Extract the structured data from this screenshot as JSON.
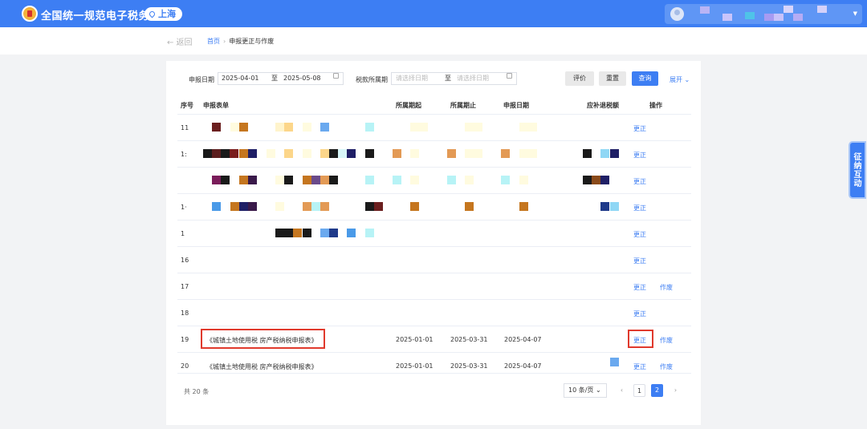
{
  "header": {
    "title": "全国统一规范电子税务局",
    "region": "上海"
  },
  "subnav": {
    "back": "← 返回",
    "breadcrumb_home": "首页",
    "breadcrumb_sep": "›",
    "breadcrumb_current": "申报更正与作废"
  },
  "filters": {
    "declare_date_label": "申报日期",
    "declare_start": "2025-04-01",
    "to_label": "至",
    "declare_end": "2025-05-08",
    "period_label": "税款所属期",
    "period_start_placeholder": "请选择日期",
    "period_end_placeholder": "请选择日期",
    "btn_evaluate": "评价",
    "btn_reset": "重置",
    "btn_query": "查询",
    "expand": "展开 ⌄"
  },
  "table": {
    "headers": [
      "序号",
      "申报表单",
      "所属期起",
      "所属期止",
      "申报日期",
      "应补退税额",
      "操作"
    ],
    "rows": [
      {
        "no": "11",
        "form": "",
        "start": "",
        "end": "",
        "date": "",
        "amount": "",
        "ops": [
          "更正"
        ]
      },
      {
        "no": "1:",
        "form": "",
        "start": "",
        "end": "",
        "date": "",
        "amount": "",
        "ops": [
          "更正"
        ]
      },
      {
        "no": "",
        "form": "",
        "start": "",
        "end": "",
        "date": "",
        "amount": "",
        "ops": [
          "更正"
        ]
      },
      {
        "no": "1·",
        "form": "",
        "start": "",
        "end": "",
        "date": "",
        "amount": "",
        "ops": [
          "更正"
        ]
      },
      {
        "no": "1",
        "form": "",
        "start": "",
        "end": "",
        "date": "",
        "amount": "",
        "ops": [
          "更正"
        ]
      },
      {
        "no": "16",
        "form": "",
        "start": "",
        "end": "",
        "date": "",
        "amount": "",
        "ops": [
          "更正"
        ]
      },
      {
        "no": "17",
        "form": "",
        "start": "",
        "end": "",
        "date": "",
        "amount": "",
        "ops": [
          "更正",
          "作废"
        ]
      },
      {
        "no": "18",
        "form": "",
        "start": "",
        "end": "",
        "date": "",
        "amount": "",
        "ops": [
          "更正"
        ]
      },
      {
        "no": "19",
        "form": "《城镇土地使用税 房产税纳税申报表》",
        "start": "2025-01-01",
        "end": "2025-03-31",
        "date": "2025-04-07",
        "amount": "",
        "ops": [
          "更正",
          "作废"
        ]
      },
      {
        "no": "20",
        "form": "《城镇土地使用税 房产税纳税申报表》",
        "start": "2025-01-01",
        "end": "2025-03-31",
        "date": "2025-04-07",
        "amount": "",
        "ops": [
          "更正",
          "作废"
        ]
      }
    ]
  },
  "pagination": {
    "total": "共 20 条",
    "page_size": "10 条/页 ⌄",
    "prev": "‹",
    "next": "›",
    "pages": [
      "1",
      "2"
    ],
    "active_page": "2"
  },
  "side_tab": "征纳互动",
  "colors": {
    "brand": "#3d7ef3",
    "highlight": "#e03a2d"
  },
  "icons": [
    "logo-icon",
    "location-pin-icon",
    "avatar-icon",
    "calendar-icon",
    "chevron-down-icon"
  ]
}
